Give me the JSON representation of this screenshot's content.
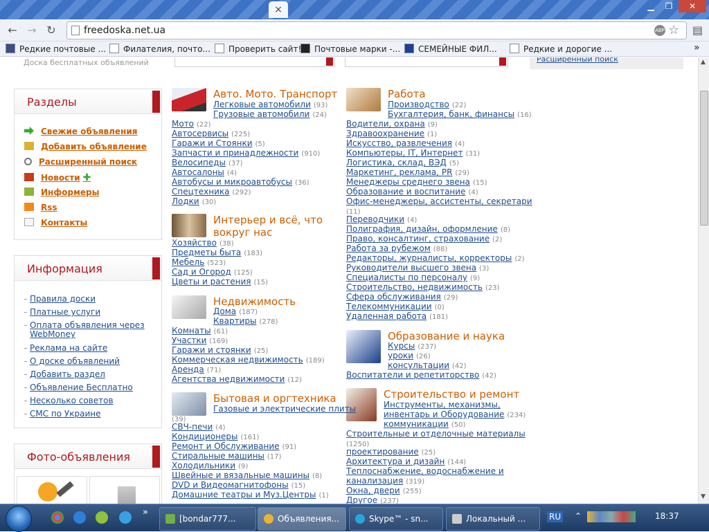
{
  "browser": {
    "tab_close": "×",
    "controls": {
      "min": "▁",
      "max": "❐",
      "close": "✕"
    },
    "back": "←",
    "forward": "→",
    "reload": "↻",
    "url": "freedoska.net.ua",
    "abp": "ABP",
    "bookmarks": [
      "Редкие почтовые ...",
      "Филателия, почто...",
      "Проверить сайт!",
      "Почтовые марки -...",
      "СЕМЕЙНЫЕ ФИЛ...",
      "Редкие и дорогие ..."
    ],
    "more_bookmarks": "»"
  },
  "header": {
    "tagline": "Доска бесплатных объявлений",
    "advanced_search": "Расширенный поиск"
  },
  "sections": {
    "title": "Разделы",
    "items": [
      {
        "label": "Свежие объявления",
        "icon": "arrow-right-icon",
        "color": "#39a835"
      },
      {
        "label": "Добавить объявление",
        "icon": "add-folder-icon",
        "color": "#d9b233"
      },
      {
        "label": "Расширенный поиск",
        "icon": "search-icon",
        "color": "#777777"
      },
      {
        "label": "Новости",
        "icon": "news-icon",
        "color": "#c93b1a"
      },
      {
        "label": "Информеры",
        "icon": "informer-icon",
        "color": "#8fb23a"
      },
      {
        "label": "Rss",
        "icon": "rss-icon",
        "color": "#f28a1e"
      },
      {
        "label": "Контакты",
        "icon": "mail-icon",
        "color": "#aaaaaa"
      }
    ]
  },
  "information": {
    "title": "Информация",
    "items": [
      "Правила доски",
      "Платные услуги",
      "Оплата объявления через WebMoney",
      "Реклама на сайте",
      "О доске объявлений",
      "Добавить раздел",
      "Объявление Бесплатно",
      "Несколько советов",
      "СМС по Украине"
    ]
  },
  "photo_ads": {
    "title": "Фото-объявления"
  },
  "col1": {
    "auto": {
      "title": "Авто. Мото. Транспорт",
      "links": [
        {
          "t": "Легковые автомобили",
          "c": "(93)"
        },
        {
          "t": "Грузовые автомобили",
          "c": "(24)"
        },
        {
          "t": "Мото",
          "c": "(22)"
        },
        {
          "t": "Автосервисы",
          "c": "(225)"
        },
        {
          "t": "Гаражи и Стоянки",
          "c": "(5)"
        },
        {
          "t": "Запчасти и принадлежности",
          "c": "(910)"
        },
        {
          "t": "Велосипеды",
          "c": "(37)"
        },
        {
          "t": "Автосалоны",
          "c": "(4)"
        },
        {
          "t": "Автобусы и микроавтобусы",
          "c": "(36)"
        },
        {
          "t": "Спецтехника",
          "c": "(292)"
        },
        {
          "t": "Лодки",
          "c": "(30)"
        }
      ]
    },
    "interior": {
      "title1": "Интерьер и всё, что",
      "title2": "вокруг нас",
      "links": [
        {
          "t": "Хозяйство",
          "c": "(38)"
        },
        {
          "t": "Предметы быта",
          "c": "(183)"
        },
        {
          "t": "Мебель",
          "c": "(523)"
        },
        {
          "t": "Сад и Огород",
          "c": "(125)"
        },
        {
          "t": "Цветы и растения",
          "c": "(15)"
        }
      ]
    },
    "realty": {
      "title": "Недвижимость",
      "links": [
        {
          "t": "Дома",
          "c": "(187)"
        },
        {
          "t": "Квартиры",
          "c": "(278)"
        },
        {
          "t": "Комнаты",
          "c": "(61)"
        },
        {
          "t": "Участки",
          "c": "(169)"
        },
        {
          "t": "Гаражи и стоянки",
          "c": "(25)"
        },
        {
          "t": "Коммерческая недвижимость",
          "c": "(189)"
        },
        {
          "t": "Аренда",
          "c": "(71)"
        },
        {
          "t": "Агентства недвижимости",
          "c": "(12)"
        }
      ]
    },
    "appliances": {
      "title": "Бытовая и оргтехника",
      "links": [
        {
          "t": "Газовые и электрические плиты",
          "c": "(39)"
        },
        {
          "t": "СВЧ-печи",
          "c": "(4)"
        },
        {
          "t": "Кондиционеры",
          "c": "(161)"
        },
        {
          "t": "Ремонт и Обслуживание",
          "c": "(91)"
        },
        {
          "t": "Стиральные машины",
          "c": "(17)"
        },
        {
          "t": "Холодильники",
          "c": "(9)"
        },
        {
          "t": "Швейные и вязальные машины",
          "c": "(8)"
        },
        {
          "t": "DVD и Видеомагнитофоны",
          "c": "(15)"
        },
        {
          "t": "Домашние театры и Муз.Центры",
          "c": "(1)"
        }
      ]
    }
  },
  "col2": {
    "work": {
      "title": "Работа",
      "links": [
        {
          "t": "Производство",
          "c": "(22)"
        },
        {
          "t": "Бухгалтерия, банк, финансы",
          "c": "(16)"
        },
        {
          "t": "Водители, охрана",
          "c": "(9)"
        },
        {
          "t": "Здравоохранение",
          "c": "(1)"
        },
        {
          "t": "Искусство, развлечения",
          "c": "(4)"
        },
        {
          "t": "Компьютеры, IT, Интернет",
          "c": "(31)"
        },
        {
          "t": "Логистика, склад, ВЭД",
          "c": "(5)"
        },
        {
          "t": "Маркетинг, реклама, PR",
          "c": "(29)"
        },
        {
          "t": "Менеджеры среднего звена",
          "c": "(15)"
        },
        {
          "t": "Образование и воспитание",
          "c": "(4)"
        },
        {
          "t": "Офис-менеджеры, ассистенты, секретари",
          "c": "(11)"
        },
        {
          "t": "Переводчики",
          "c": "(4)"
        },
        {
          "t": "Полиграфия, дизайн, оформление",
          "c": "(8)"
        },
        {
          "t": "Право, консалтинг, страхование",
          "c": "(2)"
        },
        {
          "t": "Работа за рубежом",
          "c": "(88)"
        },
        {
          "t": "Редакторы, журналисты, корректоры",
          "c": "(2)"
        },
        {
          "t": "Руководители высшего звена",
          "c": "(3)"
        },
        {
          "t": "Специалисты по персоналу",
          "c": "(9)"
        },
        {
          "t": "Строительство, недвижимость",
          "c": "(23)"
        },
        {
          "t": "Сфера обслуживания",
          "c": "(29)"
        },
        {
          "t": "Телекоммуникации",
          "c": "(0)"
        },
        {
          "t": "Удаленная работа",
          "c": "(181)"
        }
      ]
    },
    "education": {
      "title": "Образование и наука",
      "links": [
        {
          "t": "Курсы",
          "c": "(237)"
        },
        {
          "t": "уроки",
          "c": "(26)"
        },
        {
          "t": "консультации",
          "c": "(42)"
        },
        {
          "t": "Воспитатели и репетиторство",
          "c": "(42)"
        }
      ]
    },
    "construction": {
      "title": "Строительство и ремонт",
      "links": [
        {
          "t": "Инструменты, механизмы,",
          "c": ""
        },
        {
          "t": "инвентарь и Оборудование",
          "c": "(234)"
        },
        {
          "t": "коммуникации",
          "c": "(50)"
        },
        {
          "t": "Строительные и отделочные материалы",
          "c": "(1250)"
        },
        {
          "t": "проектирование",
          "c": "(25)"
        },
        {
          "t": "Архитектура и дизайн",
          "c": "(144)"
        },
        {
          "t": "Теплоснабжение, водоснабжение и",
          "c": ""
        },
        {
          "t": "канализация",
          "c": "(319)"
        },
        {
          "t": "Окна, двери",
          "c": "(255)"
        },
        {
          "t": "Другое",
          "c": "(237)"
        }
      ]
    }
  },
  "taskbar": {
    "tasks": [
      {
        "label": "[bondar777...",
        "color": "#6fb04a"
      },
      {
        "label": "Объявления...",
        "color": "#e8b33a",
        "active": true
      },
      {
        "label": "Skype™ - sn...",
        "color": "#2aa3e0"
      },
      {
        "label": "Локальный ...",
        "color": "#cccccc"
      }
    ],
    "lang": "RU",
    "clock": "18:37",
    "more": "»"
  }
}
